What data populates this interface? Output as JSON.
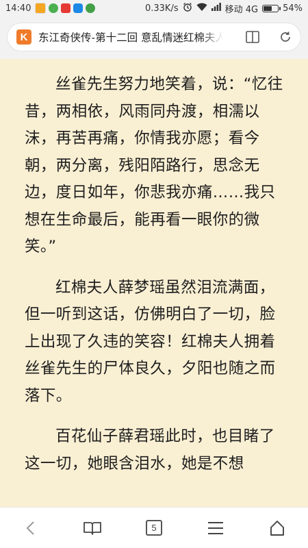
{
  "status_bar": {
    "time": "14:40",
    "network_speed": "0.33K/s",
    "carrier": "移动 4G",
    "battery_percent": "54%",
    "battery_level": 0.54,
    "notification_icons": [
      "app-icon",
      "wechat-icon",
      "red-packet-icon",
      "qq-icon",
      "green-app-icon"
    ]
  },
  "browser": {
    "page_title": "东江奇侠传-第十二回 意乱情迷红棉夫人",
    "logo_letter": "K",
    "tab_count": "5"
  },
  "article": {
    "paragraphs": [
      "丝雀先生努力地笑着，说：“忆往昔，两相依，风雨同舟渡，相濡以沫，再苦再痛，你情我亦愿；看今朝，两分离，残阳陌路行，思念无边，度日如年，你悲我亦痛……我只想在生命最后，能再看一眼你的微笑。”",
      "红棉夫人薛梦瑶虽然泪流满面，但一听到这话，仿佛明白了一切，脸上出现了久违的笑容！红棉夫人拥着丝雀先生的尸体良久，夕阳也随之而落下。",
      "百花仙子薛君瑶此时，也目睹了这一切，她眼含泪水，她是不想"
    ]
  },
  "colors": {
    "page_background": "#f9efd3",
    "logo_orange": "#f07b2a"
  }
}
